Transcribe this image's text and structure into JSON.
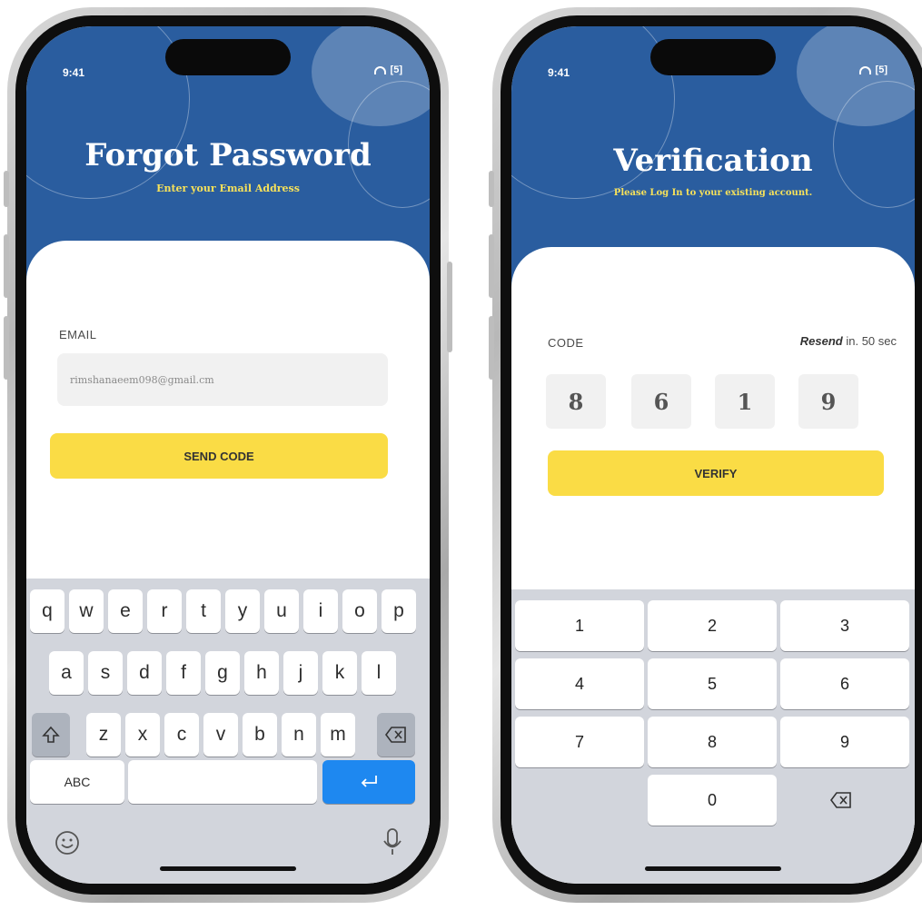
{
  "status": {
    "time": "9:41",
    "battery": "[5]"
  },
  "forgot": {
    "title": "Forgot Password",
    "subtitle": "Enter your Email Address",
    "email_label": "EMAIL",
    "email_value": "rimshanaeem098@gmail.cm",
    "send_label": "SEND CODE",
    "keys_row1": [
      "q",
      "w",
      "e",
      "r",
      "t",
      "y",
      "u",
      "i",
      "o",
      "p"
    ],
    "keys_row2": [
      "a",
      "s",
      "d",
      "f",
      "g",
      "h",
      "j",
      "k",
      "l"
    ],
    "keys_row3": [
      "z",
      "x",
      "c",
      "v",
      "b",
      "n",
      "m"
    ],
    "abc_label": "ABC"
  },
  "verify": {
    "title": "Verification",
    "subtitle": "Please Log In to your existing account.",
    "code_label": "CODE",
    "resend_label": "Resend",
    "resend_suffix": " in. 50 sec",
    "digits": [
      "8",
      "6",
      "1",
      "9"
    ],
    "verify_label": "VERIFY",
    "numpad": [
      "1",
      "2",
      "3",
      "4",
      "5",
      "6",
      "7",
      "8",
      "9",
      "0"
    ]
  },
  "colors": {
    "header": "#2a5d9f",
    "accent": "#fadc45",
    "subtitle": "#f6e15a",
    "return_key": "#1e88f0"
  },
  "icons": [
    "wifi-icon",
    "battery-icon",
    "shift-icon",
    "delete-icon",
    "return-icon",
    "emoji-icon",
    "mic-icon"
  ]
}
